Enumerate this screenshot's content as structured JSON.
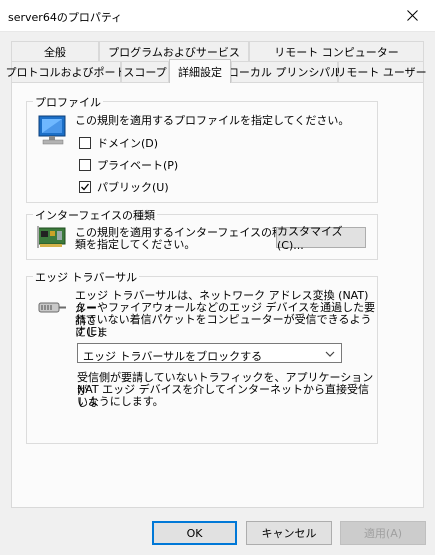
{
  "window": {
    "title": "server64のプロパティ"
  },
  "tabs": {
    "row1": [
      "全般",
      "プログラムおよびサービス",
      "リモート コンピューター"
    ],
    "row2": [
      "プロトコルおよびポート",
      "スコープ",
      "詳細設定",
      "ローカル プリンシパル",
      "リモート ユーザー"
    ],
    "active": "詳細設定"
  },
  "profile": {
    "label": "プロファイル",
    "desc": "この規則を適用するプロファイルを指定してください。",
    "domain": {
      "label": "ドメイン(D)",
      "checked": false
    },
    "private": {
      "label": "プライベート(P)",
      "checked": false
    },
    "public": {
      "label": "パブリック(U)",
      "checked": true
    }
  },
  "iface": {
    "label": "インターフェイスの種類",
    "desc_line1": "この規則を適用するインターフェイスの種",
    "desc_line2": "類を指定してください。",
    "customize": "カスタマイズ(C)..."
  },
  "edge": {
    "label": "エッジ トラバーサル",
    "desc_line1": "エッジ トラバーサルは、ネットワーク アドレス変換 (NAT) ルー",
    "desc_line2": "ターやファイアウォールなどのエッジ デバイスを通過した要請さ",
    "desc_line3": "れていない着信パケットをコンピューターが受信できるようにしま",
    "desc_line4": "す(E)",
    "selected": "エッジ トラバーサルをブロックする",
    "note_line1": "受信側が要請していないトラフィックを、アプリケーションが",
    "note_line2": "NAT エッジ デバイスを介してインターネットから直接受信しな",
    "note_line3": "いようにします。"
  },
  "buttons": {
    "ok": "OK",
    "cancel": "キャンセル",
    "apply": "適用(A)"
  },
  "colors": {
    "accent": "#0078d7",
    "panel": "#fbfbfb",
    "window": "#f0f0f0"
  }
}
